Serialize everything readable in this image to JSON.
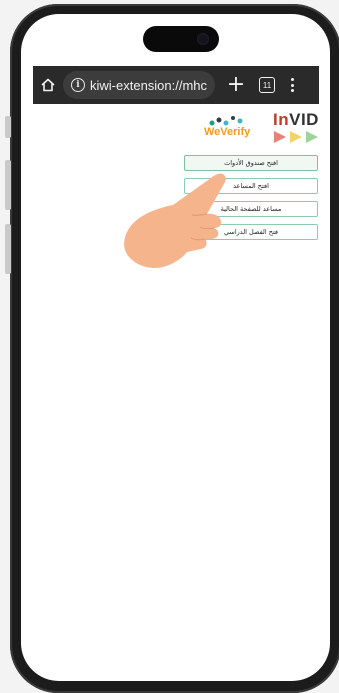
{
  "browser": {
    "url": "kiwi-extension://mhccp"
  },
  "tabs_count": "11",
  "logos": {
    "weverify": "WeVerify",
    "invid_prefix": "In",
    "invid_suffix": "VID"
  },
  "extension_buttons": [
    {
      "label": "افتح صندوق الأدوات"
    },
    {
      "label": "افتح المساعد"
    },
    {
      "label": "مساعد للصفحة الحالية"
    },
    {
      "label": "فتح الفصل الدراسي"
    }
  ],
  "colors": {
    "button_border": "#8ecab2",
    "weverify_orange": "#f39c1a",
    "invid_red": "#c0392b",
    "hand_skin": "#f6b48d"
  },
  "icons": [
    "home-icon",
    "info-icon",
    "plus-icon",
    "tabs-icon",
    "menu-icon",
    "pointing-hand-icon"
  ]
}
